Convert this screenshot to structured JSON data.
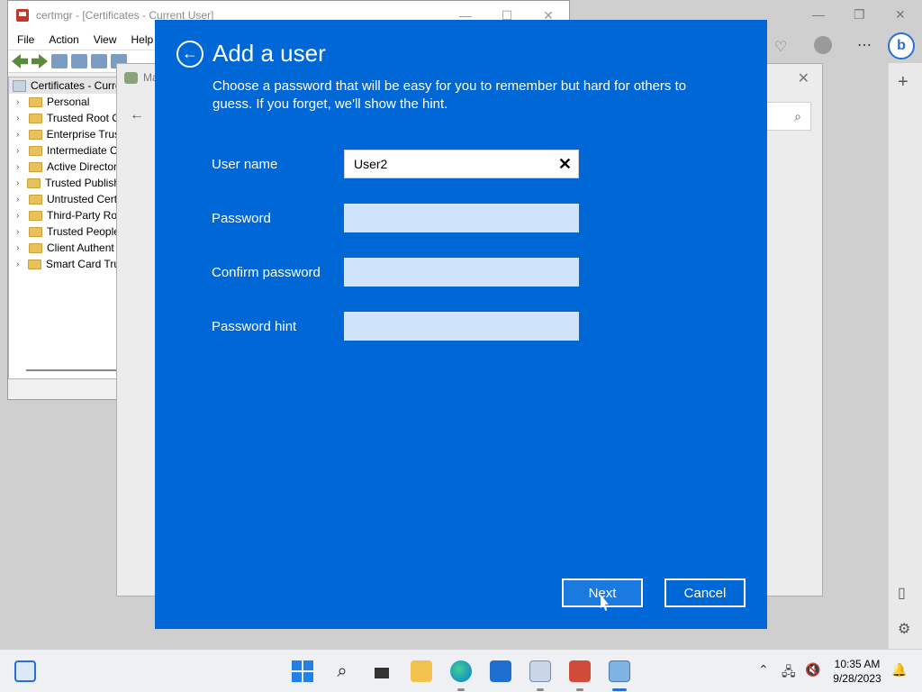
{
  "certmgr": {
    "title": "certmgr - [Certificates - Current User]",
    "menu": [
      "File",
      "Action",
      "View",
      "Help"
    ],
    "tree_root": "Certificates - Curre",
    "tree_items": [
      "Personal",
      "Trusted Root C",
      "Enterprise Trus",
      "Intermediate C",
      "Active Director",
      "Trusted Publish",
      "Untrusted Cert",
      "Third-Party Ro",
      "Trusted People",
      "Client Authent",
      "Smart Card Tru"
    ]
  },
  "mgmt_window": {
    "title": "Ma"
  },
  "dialog": {
    "title": "Add a user",
    "description": "Choose a password that will be easy for you to remember but hard for others to guess. If you forget, we'll show the hint.",
    "fields": {
      "username_label": "User name",
      "username_value": "User2",
      "password_label": "Password",
      "confirm_label": "Confirm password",
      "hint_label": "Password hint"
    },
    "buttons": {
      "next": "Next",
      "cancel": "Cancel"
    },
    "colors": {
      "background": "#0067d6",
      "empty_field": "#cfe4fb"
    }
  },
  "taskbar": {
    "time": "10:35 AM",
    "date": "9/28/2023"
  }
}
